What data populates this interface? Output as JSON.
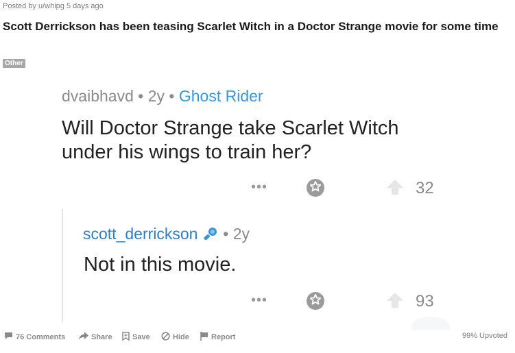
{
  "post": {
    "posted_by": "Posted by u/whipg 5 days ago",
    "title": "Scott Derrickson has been teasing Scarlet Witch in a Doctor Strange movie for some time",
    "flair": "Other"
  },
  "comment1": {
    "author": "dvaibhavd",
    "age": "2y",
    "flair": "Ghost Rider",
    "sep": "•",
    "text": "Will Doctor Strange take Scarlet Witch under his wings to train her?",
    "score": "32",
    "more": "•••"
  },
  "comment2": {
    "author": "scott_derrickson",
    "age": "2y",
    "sep": "•",
    "text": "Not in this movie.",
    "score": "93",
    "more": "•••"
  },
  "footer": {
    "comments": "76 Comments",
    "share": "Share",
    "save": "Save",
    "hide": "Hide",
    "report": "Report",
    "upvoted": "99% Upvoted"
  },
  "icons": {
    "comments": "comment-bubble-icon",
    "share": "share-arrow-icon",
    "save": "bookmark-plus-icon",
    "hide": "hide-circle-slash-icon",
    "report": "flag-icon",
    "award": "star-award-icon",
    "upvote": "upvote-arrow-icon",
    "verified": "microphone-badge-icon"
  },
  "colors": {
    "flair_text": "#3a96d8",
    "author_link": "#2f7fc1",
    "muted": "#8a8a8a"
  }
}
